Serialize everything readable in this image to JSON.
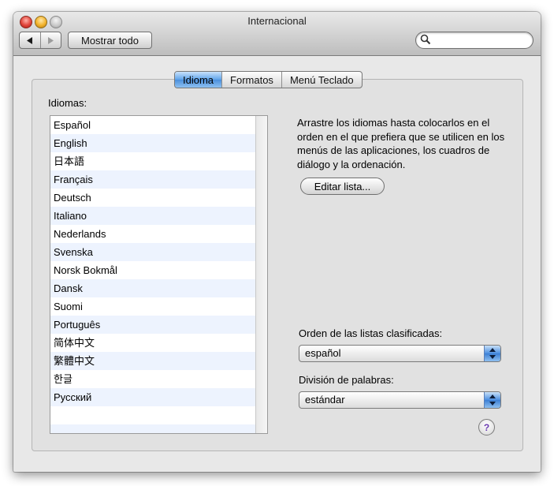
{
  "window": {
    "title": "Internacional",
    "show_all_label": "Mostrar todo",
    "search_placeholder": ""
  },
  "tabs": [
    {
      "label": "Idioma",
      "active": true
    },
    {
      "label": "Formatos",
      "active": false
    },
    {
      "label": "Menú Teclado",
      "active": false
    }
  ],
  "idioma": {
    "list_label": "Idiomas:",
    "languages": [
      "Español",
      "English",
      "日本語",
      "Français",
      "Deutsch",
      "Italiano",
      "Nederlands",
      "Svenska",
      "Norsk Bokmål",
      "Dansk",
      "Suomi",
      "Português",
      "简体中文",
      "繁體中文",
      "한글",
      "Русский"
    ],
    "hint": "Arrastre los idiomas hasta colocarlos en el orden en el que prefiera que se utilicen en los menús de las aplicaciones, los cuadros de diálogo y la ordenación.",
    "edit_button": "Editar lista...",
    "sort_order_label": "Orden de las listas clasificadas:",
    "sort_order_value": "español",
    "word_break_label": "División de palabras:",
    "word_break_value": "estándar",
    "help_label": "?"
  },
  "colors": {
    "accent": "#4b8fdc",
    "row_alt": "#edf3fe",
    "window_bg": "#e8e8e8"
  }
}
